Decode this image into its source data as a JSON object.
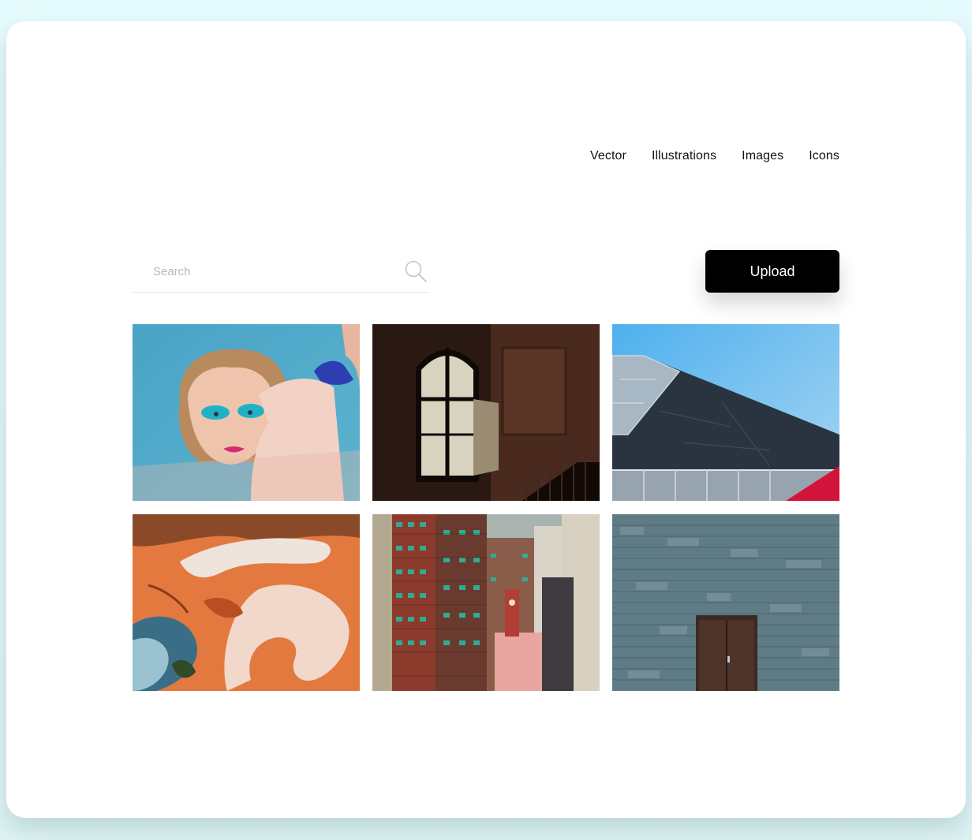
{
  "nav": {
    "items": [
      {
        "label": "Vector"
      },
      {
        "label": "Illustrations"
      },
      {
        "label": "Images"
      },
      {
        "label": "Icons"
      }
    ]
  },
  "search": {
    "placeholder": "Search",
    "value": ""
  },
  "upload": {
    "label": "Upload"
  },
  "gallery": {
    "images": [
      {
        "name": "portrait-makeup-image"
      },
      {
        "name": "window-interior-image"
      },
      {
        "name": "building-roof-image"
      },
      {
        "name": "abstract-aerial-image"
      },
      {
        "name": "city-buildings-image"
      },
      {
        "name": "stone-wall-door-image"
      }
    ]
  },
  "colors": {
    "background": "#e6fbfd",
    "card": "#ffffff",
    "button": "#000000",
    "button_text": "#ffffff"
  }
}
